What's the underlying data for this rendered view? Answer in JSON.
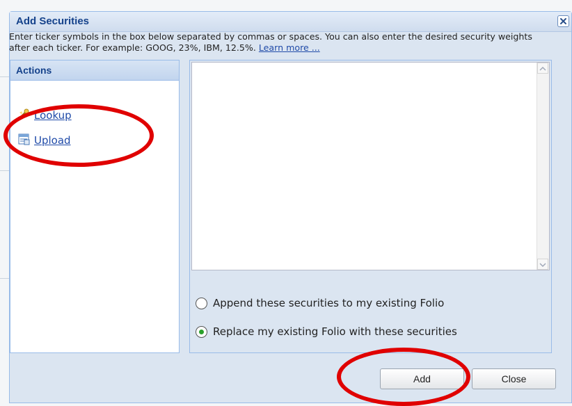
{
  "dialog": {
    "title": "Add Securities",
    "close_icon": "close-x-icon",
    "instructions": "Enter ticker symbols in the box below separated by commas or spaces. You can also enter the desired security weights after each ticker. For example: GOOG, 23%, IBM, 12.5%.",
    "learn_more": "Learn more ..."
  },
  "actions": {
    "header": "Actions",
    "items": [
      {
        "label": "Lookup",
        "icon": "lookup-wand-icon"
      },
      {
        "label": "Upload",
        "icon": "upload-list-icon"
      }
    ]
  },
  "ticker_input": {
    "value": ""
  },
  "options": [
    {
      "label": "Append these securities to my existing Folio",
      "checked": false
    },
    {
      "label": "Replace my existing Folio with these securities",
      "checked": true
    }
  ],
  "buttons": {
    "add": "Add",
    "close": "Close"
  },
  "colors": {
    "accent": "#15428b",
    "link": "#1f4aa8",
    "annotation": "#e00000",
    "radio_dot": "#2aa02a"
  }
}
